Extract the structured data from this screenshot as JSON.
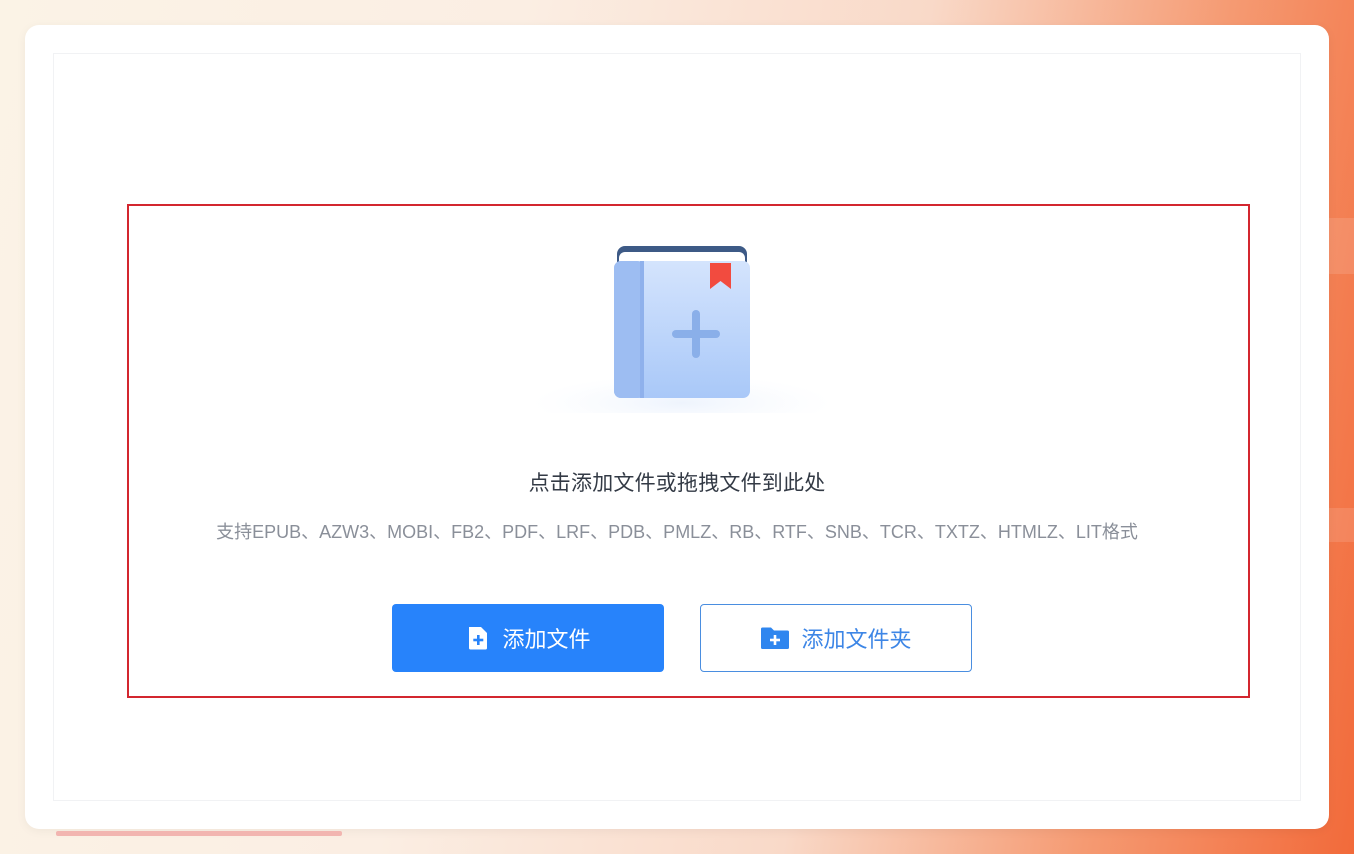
{
  "upload": {
    "title": "点击添加文件或拖拽文件到此处",
    "formats": "支持EPUB、AZW3、MOBI、FB2、PDF、LRF、PDB、PMLZ、RB、RTF、SNB、TCR、TXTZ、HTMLZ、LIT格式",
    "add_file_label": "添加文件",
    "add_folder_label": "添加文件夹"
  },
  "icons": {
    "illustration": "book-add-icon",
    "add_file": "file-add-icon",
    "add_folder": "folder-add-icon"
  },
  "colors": {
    "primary": "#2783fb",
    "drop_zone_border": "#d3262f",
    "book": "#b8d3fb",
    "bookmark": "#f24b3f"
  }
}
